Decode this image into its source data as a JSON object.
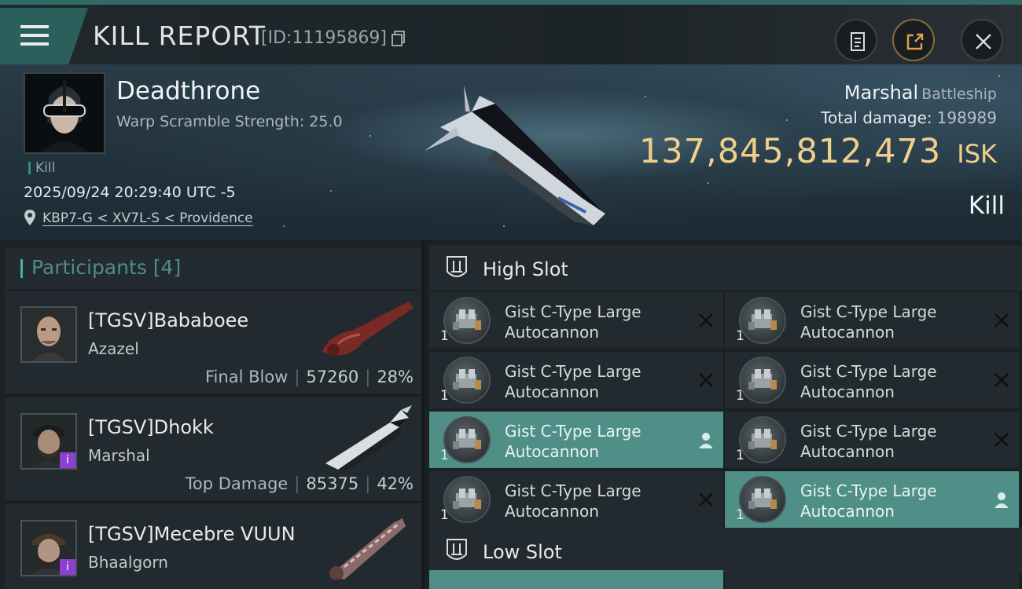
{
  "header": {
    "title": "KILL REPORT",
    "report_id": "[ID:11195869]",
    "icons": {
      "menu": "menu-icon",
      "copy": "copy-icon",
      "clipboard": "clipboard-icon",
      "share": "share-icon",
      "close": "close-icon"
    }
  },
  "victim": {
    "name": "Deadthrone",
    "warp_scramble": "Warp Scramble Strength: 25.0",
    "kill_tag": "Kill",
    "datetime": "2025/09/24 20:29:40 UTC -5",
    "location": "KBP7-G < XV7L-S < Providence",
    "ship_name": "Marshal",
    "ship_class": "Battleship",
    "total_damage_label": "Total damage:",
    "total_damage": "198989",
    "isk_value": "137,845,812,473",
    "isk_unit": "ISK",
    "result": "Kill"
  },
  "participants": {
    "title": "Participants [4]",
    "rows": [
      {
        "name": "[TGSV]Bababoee",
        "ship": "Azazel",
        "role": "Final Blow",
        "damage": "57260",
        "percent": "28%"
      },
      {
        "name": "[TGSV]Dhokk",
        "ship": "Marshal",
        "role": "Top Damage",
        "damage": "85375",
        "percent": "42%",
        "badge": "i"
      },
      {
        "name": "[TGSV]Mecebre VUUN",
        "ship": "Bhaalgorn",
        "badge": "i"
      }
    ]
  },
  "fitting": {
    "high_slot": {
      "title": "High Slot",
      "modules": [
        {
          "name": "Gist C-Type Large Autocannon",
          "qty": "1",
          "status": "destroyed"
        },
        {
          "name": "Gist C-Type Large Autocannon",
          "qty": "1",
          "status": "destroyed"
        },
        {
          "name": "Gist C-Type Large Autocannon",
          "qty": "1",
          "status": "destroyed"
        },
        {
          "name": "Gist C-Type Large Autocannon",
          "qty": "1",
          "status": "destroyed"
        },
        {
          "name": "Gist C-Type Large Autocannon",
          "qty": "1",
          "status": "dropped"
        },
        {
          "name": "Gist C-Type Large Autocannon",
          "qty": "1",
          "status": "destroyed"
        },
        {
          "name": "Gist C-Type Large Autocannon",
          "qty": "1",
          "status": "destroyed"
        },
        {
          "name": "Gist C-Type Large Autocannon",
          "qty": "1",
          "status": "dropped"
        }
      ]
    },
    "low_slot": {
      "title": "Low Slot"
    }
  },
  "colors": {
    "accent": "#4f8f88",
    "isk": "#f1cf8a",
    "badge": "#8d3fd1"
  }
}
